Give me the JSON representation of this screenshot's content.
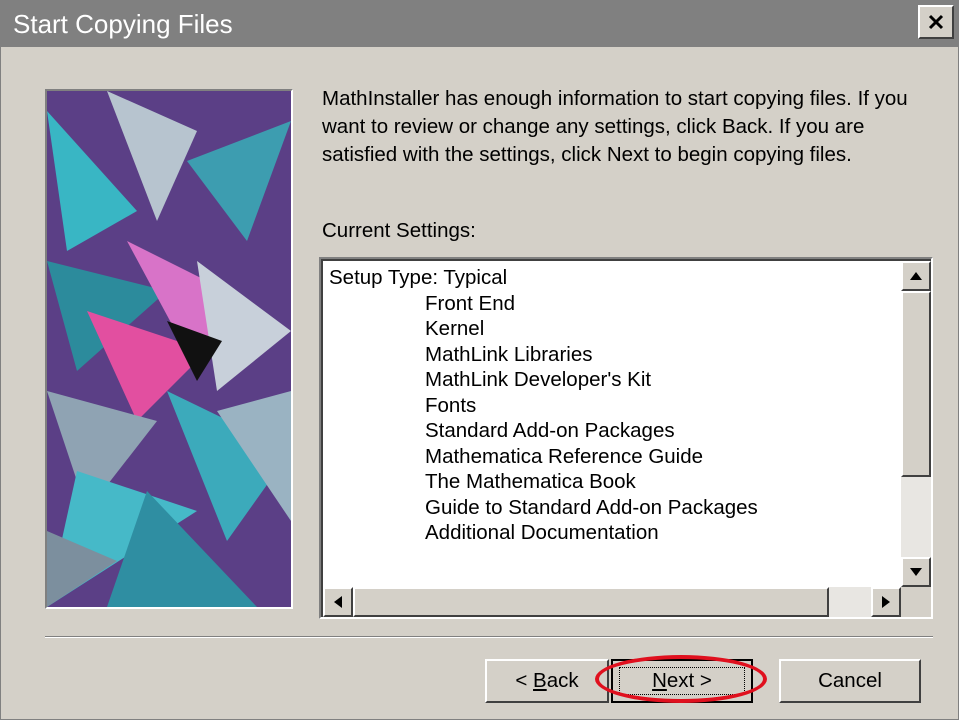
{
  "window": {
    "title": "Start Copying Files"
  },
  "intro_text": "MathInstaller has enough information to start copying files.  If you want to review or change any settings, click Back.  If you are satisfied with the settings, click Next to begin copying files.",
  "settings": {
    "label": "Current Settings:",
    "setup_type": "Setup Type: Typical",
    "items": [
      "Front End",
      "Kernel",
      "MathLink Libraries",
      "MathLink Developer's Kit",
      "Fonts",
      "Standard Add-on Packages",
      "Mathematica Reference Guide",
      "The Mathematica Book",
      "Guide to Standard Add-on Packages",
      "Additional Documentation"
    ]
  },
  "buttons": {
    "back": {
      "prefix": "< ",
      "mnemonic": "B",
      "rest": "ack"
    },
    "next": {
      "mnemonic": "N",
      "rest": "ext >"
    },
    "cancel": "Cancel"
  },
  "colors": {
    "highlight_ring": "#e0101e",
    "dialog_face": "#d4d0c8",
    "titlebar": "#808080"
  },
  "icons": [
    "close-icon",
    "scroll-up-arrow-icon",
    "scroll-down-arrow-icon",
    "scroll-left-arrow-icon",
    "scroll-right-arrow-icon"
  ]
}
